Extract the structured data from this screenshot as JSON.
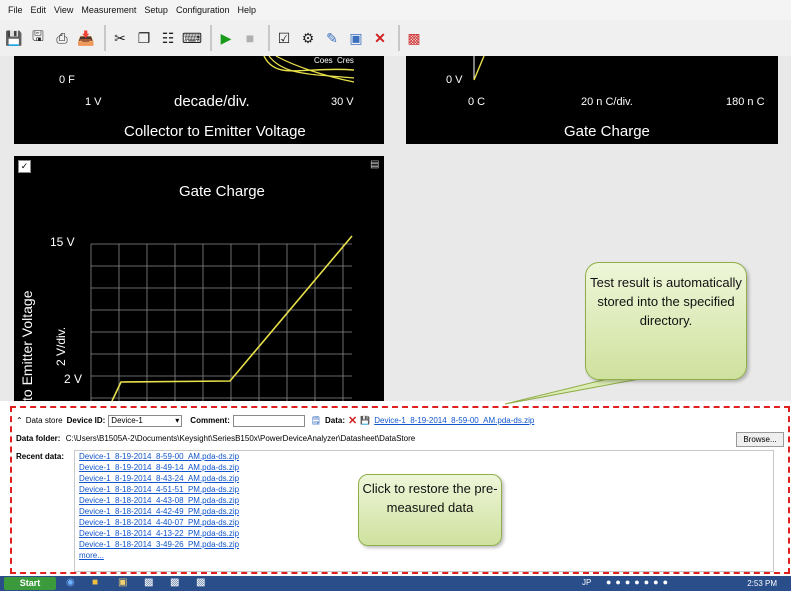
{
  "menu": [
    "File",
    "Edit",
    "View",
    "Measurement",
    "Setup",
    "Configuration",
    "Help"
  ],
  "colors": {
    "trace": "#e8e04a",
    "panel_bg": "#000000",
    "callout_fill": "#dcebb4",
    "dashed_border": "#e02020",
    "link": "#1155cc"
  },
  "panel_top_left": {
    "y_zero": "0 F",
    "x_min": "1 V",
    "x_div": "decade/div.",
    "x_max": "30 V",
    "title": "Collector to Emitter Voltage",
    "legend": [
      "Coes",
      "Cres"
    ]
  },
  "panel_top_right": {
    "y_zero": "0 V",
    "x_min": "0 C",
    "x_div": "20 n C/div.",
    "x_max": "180 n C",
    "title": "Gate Charge"
  },
  "panel_main": {
    "title": "Gate Charge",
    "y_top": "15 V",
    "y_div": "2 V/div.",
    "y_bottom": "2 V",
    "y_axis_label": "to Emitter Voltage",
    "checked": true
  },
  "callout_result": "Test result is automatically stored into the specified directory.",
  "datastore": {
    "header": "Data store",
    "device_id_label": "Device ID:",
    "device_id_value": "Device-1",
    "comment_label": "Comment:",
    "comment_value": "",
    "data_label": "Data:",
    "data_file": "Device-1_8-19-2014_8-59-00_AM.pda-ds.zip",
    "folder_label": "Data folder:",
    "folder_path": "C:\\Users\\B1505A-2\\Documents\\Keysight\\SeriesB150x\\PowerDeviceAnalyzer\\Datasheet\\DataStore",
    "browse_label": "Browse...",
    "recent_label": "Recent data:",
    "recent_files": [
      "Device-1_8-19-2014_8-59-00_AM.pda-ds.zip",
      "Device-1_8-19-2014_8-49-14_AM.pda-ds.zip",
      "Device-1_8-19-2014_8-43-24_AM.pda-ds.zip",
      "Device-1_8-18-2014_4-51-51_PM.pda-ds.zip",
      "Device-1_8-18-2014_4-43-08_PM.pda-ds.zip",
      "Device-1_8-18-2014_4-42-49_PM.pda-ds.zip",
      "Device-1_8-18-2014_4-40-07_PM.pda-ds.zip",
      "Device-1_8-18-2014_4-13-22_PM.pda-ds.zip",
      "Device-1_8-18-2014_3-49-26_PM.pda-ds.zip"
    ],
    "more_label": "more..."
  },
  "callout_restore": "Click to restore the pre-measured data",
  "taskbar": {
    "start_label": "Start",
    "lang": "JP",
    "clock": "2:53 PM"
  }
}
